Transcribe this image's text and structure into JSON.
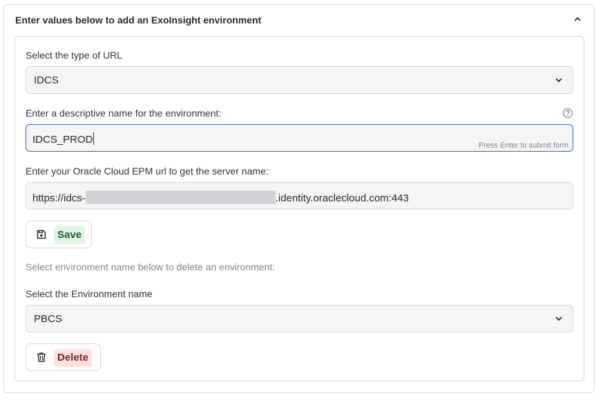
{
  "expander": {
    "title": "Enter values below to add an ExoInsight environment"
  },
  "url_type": {
    "label": "Select the type of URL",
    "value": "IDCS"
  },
  "env_name": {
    "label": "Enter a descriptive name for the environment:",
    "value": "IDCS_PROD",
    "hint": "Press Enter to submit form"
  },
  "epm_url": {
    "label": "Enter your Oracle Cloud EPM url to get the server name:",
    "value_prefix": "https://idcs-",
    "value_suffix": ".identity.oraclecloud.com:443"
  },
  "save_button": {
    "label": "Save",
    "icon": "save-icon"
  },
  "delete_hint": "Select environment name below to delete an environment:",
  "env_select": {
    "label": "Select the Environment name",
    "value": "PBCS"
  },
  "delete_button": {
    "label": "Delete",
    "icon": "trash-icon"
  },
  "colors": {
    "focus_border": "#2e6da4",
    "save_bg": "#dff5e6",
    "delete_bg": "#fde2e2"
  }
}
